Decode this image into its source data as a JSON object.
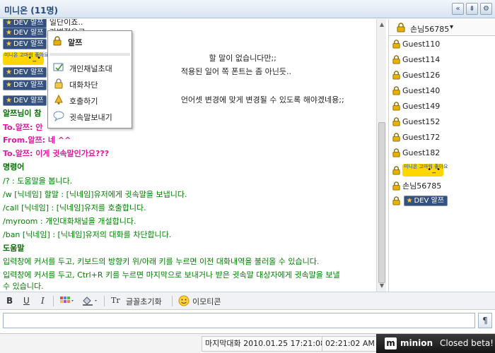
{
  "window": {
    "title": "미니온 (11명)"
  },
  "window_buttons": {
    "back": "«",
    "pin": "⇟",
    "settings": "⚙"
  },
  "colors": {
    "accent": "#25487a",
    "badge_bg": "#35517f",
    "system_green": "#008000",
    "whisper_pink": "#e0189c"
  },
  "chat": {
    "rows": [
      {
        "badge": "DEV 알쯔",
        "text": "일단이죠.."
      },
      {
        "badge": "DEV 알쯔",
        "text": "가변적으로"
      },
      {
        "badge": "DEV 알쯔",
        "text": ""
      },
      {
        "emoticon_text": "미니온 고마워 좋아요",
        "text": "할 말이 없습니다만;;",
        "text_pre": "..."
      },
      {
        "badge": "DEV 알쯔",
        "text": "적용된 일어 쪽 폰트는 좀 아닌듯.."
      },
      {
        "badge": "DEV 알쯔",
        "text": ""
      },
      {
        "badge": "DEV 알쯔",
        "text": "언어셋 변경에 맞게 변경될 수 있도록 해야겠네용;;"
      }
    ],
    "whisper_partial": "알쯔님이 참",
    "whisper_to_1": "To.알쯔: 안",
    "whisper_from": "From.알쯔: 네 ^^",
    "whisper_to_2": "To.알쯔: 이게 귓속말인가요???",
    "commands_heading": "명령어",
    "commands": [
      "/? : 도움말을 봅니다.",
      "/w [닉네임] 할말 : [닉네임]유저에게 귓속말을 보냅니다.",
      "/call [닉네임] : [닉네임]유저를 호출합니다.",
      "/myroom : 개인대화채널을 개설합니다.",
      "/ban [닉네임] : [닉네임]유저의 대화를 차단합니다."
    ],
    "help_heading": "도움말",
    "help": [
      "입력창에 커서를 두고, 키보드의 방향키 위/아래 키를 누르면 이전 대화내역을 불러올 수 있습니다.",
      "입력창에 커서를 두고, Ctrl+R 키를 누르면 마지막으로 보내거나 받은 귓속말 대상자에게 귓속말을 보낼",
      "수 있습니다."
    ]
  },
  "context_menu": {
    "user": "알쯔",
    "items": [
      {
        "label": "개인채널초대",
        "icon": "channel-invite-icon"
      },
      {
        "label": "대화차단",
        "icon": "lock-icon"
      },
      {
        "label": "호출하기",
        "icon": "bell-icon"
      },
      {
        "label": "귓속말보내기",
        "icon": "speech-bubble-icon"
      }
    ]
  },
  "user_list": {
    "header": "손님56785",
    "dropdown_glyph": "▾",
    "users": [
      "Guest110",
      "Guest114",
      "Guest126",
      "Guest140",
      "Guest149",
      "Guest152",
      "Guest172",
      "Guest182"
    ],
    "emoticon_user": "미니온 고마워 좋아요",
    "self": "손님56785",
    "dev_user": "DEV 알쯔"
  },
  "toolbar": {
    "bold": "B",
    "underline": "U",
    "italic": "I",
    "font_reset": "글꼴초기화",
    "emoticon": "이모티콘",
    "font_reset_glyph": "Tr"
  },
  "input": {
    "value": "",
    "placeholder": "",
    "send_glyph": "¶"
  },
  "status": {
    "last_chat": "마지막대화 2010.01.25 17:21:08",
    "elapsed": "02:21:02 AM",
    "brand_mark": "m",
    "brand_name": "minion",
    "brand_tag": "Closed beta!"
  }
}
